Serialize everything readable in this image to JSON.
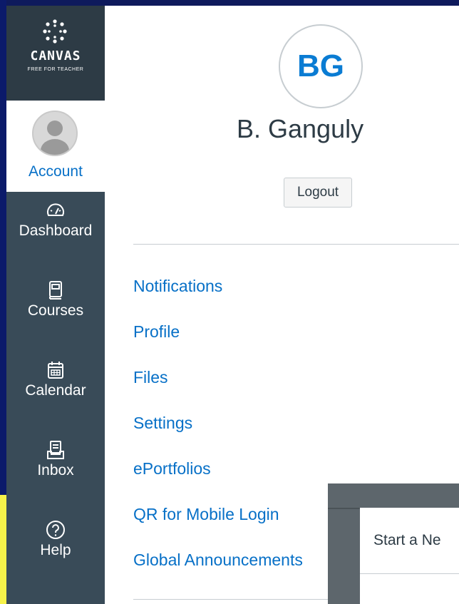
{
  "nav": {
    "brand_name": "CANVAS",
    "brand_sub": "FREE FOR TEACHER",
    "account_label": "Account",
    "items": [
      {
        "label": "Dashboard",
        "icon": "dashboard-icon"
      },
      {
        "label": "Courses",
        "icon": "courses-icon"
      },
      {
        "label": "Calendar",
        "icon": "calendar-icon"
      },
      {
        "label": "Inbox",
        "icon": "inbox-icon"
      },
      {
        "label": "Help",
        "icon": "help-icon"
      }
    ]
  },
  "profile": {
    "initials": "BG",
    "name": "B. Ganguly",
    "logout_label": "Logout"
  },
  "menu": [
    "Notifications",
    "Profile",
    "Files",
    "Settings",
    "ePortfolios",
    "QR for Mobile Login",
    "Global Announcements"
  ],
  "modal": {
    "title": "Start a Ne"
  },
  "colors": {
    "nav_bg": "#394b58",
    "brand_bg": "#2d3b45",
    "link": "#0770c7",
    "initials": "#0a7cd3"
  }
}
